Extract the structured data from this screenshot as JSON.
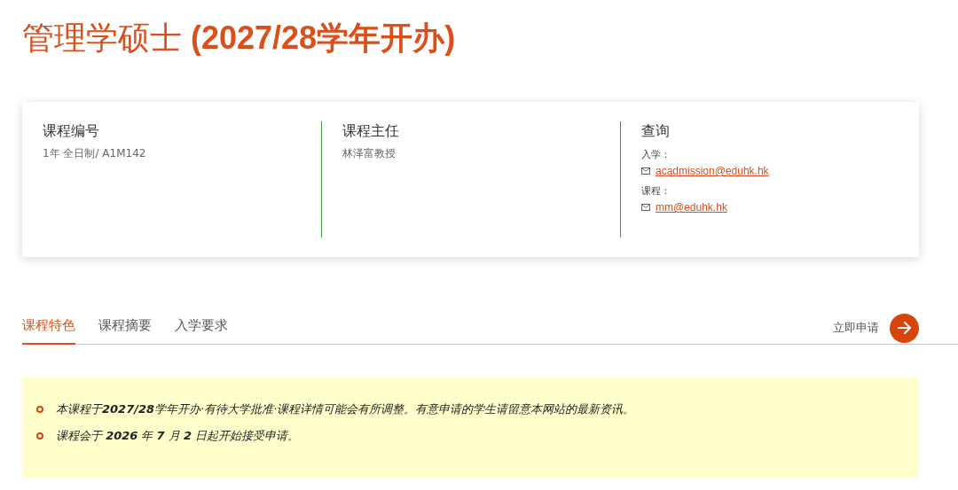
{
  "title": "管理学硕士 **(2027/28学年开办)**",
  "info_card": {
    "columns": [
      {
        "heading": "课程编号",
        "lines": [
          {
            "kind": "text",
            "text": "1年 全日制/ A1M142"
          }
        ]
      },
      {
        "heading": "课程主任",
        "lines": [
          {
            "kind": "text",
            "text": "林泽富教授"
          }
        ]
      },
      {
        "heading": "查询",
        "lines": [
          {
            "kind": "label",
            "text": "入学："
          },
          {
            "kind": "email",
            "text": "acadmission@eduhk.hk"
          },
          {
            "kind": "label",
            "text": "课程："
          },
          {
            "kind": "email",
            "text": "mm@eduhk.hk"
          }
        ]
      }
    ]
  },
  "tabs": [
    {
      "label": "课程特色",
      "selected": true
    },
    {
      "label": "课程摘要",
      "selected": false
    },
    {
      "label": "入学要求",
      "selected": false
    }
  ],
  "apply": {
    "label": "立即申请"
  },
  "notice": {
    "items": [
      "本课程于**2027/28**学年开办·有待大学批准·课程详情可能会有所调整。有意申请的学生请留意本网站的最新资讯。",
      "课程会于 **2026** 年 **7** 月 **2** 日起开始接受申请。"
    ]
  }
}
